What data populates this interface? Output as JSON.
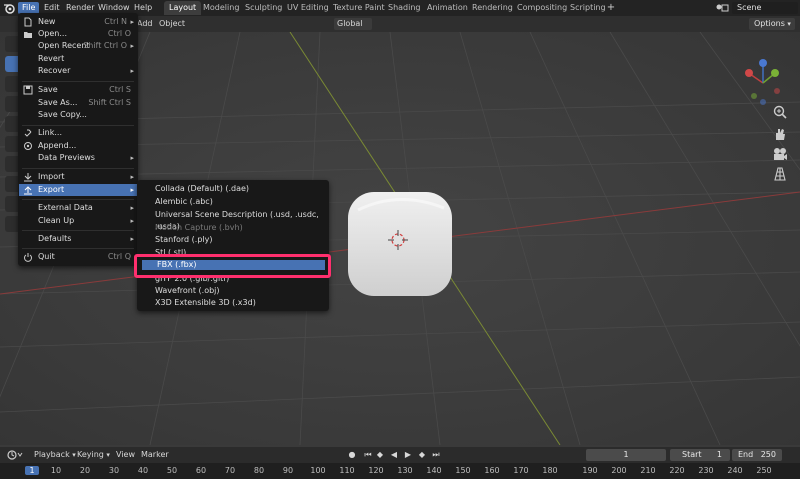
{
  "topbar": {
    "menus": [
      "File",
      "Edit",
      "Render",
      "Window",
      "Help"
    ],
    "workspaces": [
      "Layout",
      "Modeling",
      "Sculpting",
      "UV Editing",
      "Texture Paint",
      "Shading",
      "Animation",
      "Rendering",
      "Compositing",
      "Scripting"
    ],
    "active_workspace": "Layout",
    "scene": "Scene"
  },
  "viewport_header": {
    "add": "Add",
    "object": "Object",
    "orientation": "Global",
    "options": "Options"
  },
  "file_menu": {
    "items": [
      {
        "label": "New",
        "shortcut": "Ctrl N",
        "arrow": "▸"
      },
      {
        "label": "Open...",
        "shortcut": "Ctrl O"
      },
      {
        "label": "Open Recent",
        "shortcut": "Shift Ctrl O",
        "arrow": "▸"
      },
      {
        "label": "Revert"
      },
      {
        "label": "Recover",
        "arrow": "▸"
      },
      {
        "label": "Save",
        "shortcut": "Ctrl S"
      },
      {
        "label": "Save As...",
        "shortcut": "Shift Ctrl S"
      },
      {
        "label": "Save Copy..."
      },
      {
        "label": "Link..."
      },
      {
        "label": "Append..."
      },
      {
        "label": "Data Previews",
        "arrow": "▸"
      },
      {
        "label": "Import",
        "arrow": "▸"
      },
      {
        "label": "Export",
        "arrow": "▸"
      },
      {
        "label": "External Data",
        "arrow": "▸"
      },
      {
        "label": "Clean Up",
        "arrow": "▸"
      },
      {
        "label": "Defaults",
        "arrow": "▸"
      },
      {
        "label": "Quit",
        "shortcut": "Ctrl Q"
      }
    ]
  },
  "export_menu": {
    "items": [
      "Collada (Default) (.dae)",
      "Alembic (.abc)",
      "Universal Scene Description (.usd, .usdc, .usda)",
      "Motion Capture (.bvh)",
      "Stanford (.ply)",
      "Stl (.stl)",
      "FBX (.fbx)",
      "glTF 2.0 (.glb/.gltf)",
      "Wavefront (.obj)",
      "X3D Extensible 3D (.x3d)"
    ],
    "highlighted": "FBX (.fbx)"
  },
  "timeline": {
    "menus": [
      "Playback",
      "Keying",
      "View",
      "Marker"
    ],
    "current_frame": "1",
    "start_label": "Start",
    "start": "1",
    "end_label": "End",
    "end": "250",
    "ticks": [
      "1",
      "10",
      "20",
      "30",
      "40",
      "50",
      "60",
      "70",
      "80",
      "90",
      "100",
      "110",
      "120",
      "130",
      "140",
      "150",
      "160",
      "170",
      "180",
      "190",
      "200",
      "210",
      "220",
      "230",
      "240",
      "250"
    ]
  },
  "colors": {
    "accent": "#4772b3",
    "highlight_frame": "#ff2f6e"
  }
}
